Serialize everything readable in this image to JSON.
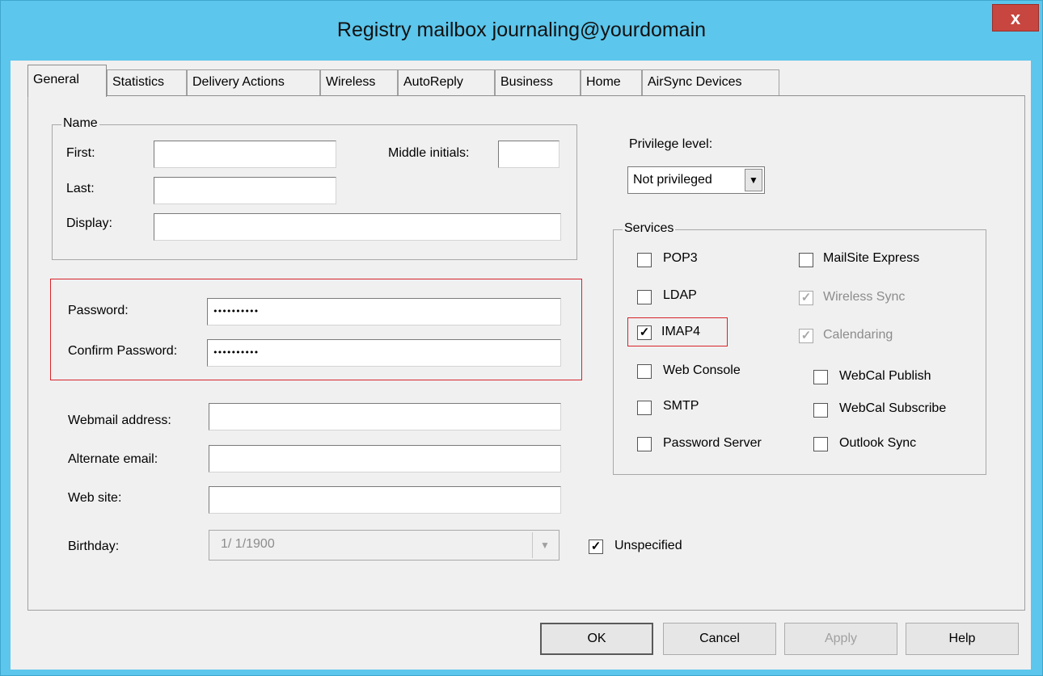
{
  "window": {
    "title": "Registry mailbox journaling@yourdomain",
    "close_label": "x"
  },
  "tabs": [
    {
      "label": "General"
    },
    {
      "label": "Statistics"
    },
    {
      "label": "Delivery Actions"
    },
    {
      "label": "Wireless"
    },
    {
      "label": "AutoReply"
    },
    {
      "label": "Business"
    },
    {
      "label": "Home"
    },
    {
      "label": "AirSync Devices"
    }
  ],
  "name_group": {
    "legend": "Name",
    "first_label": "First:",
    "first_value": "",
    "middle_label": "Middle initials:",
    "middle_value": "",
    "last_label": "Last:",
    "last_value": "",
    "display_label": "Display:",
    "display_value": ""
  },
  "password": {
    "password_label": "Password:",
    "password_value": "••••••••••",
    "confirm_label": "Confirm Password:",
    "confirm_value": "••••••••••"
  },
  "fields": {
    "webmail_label": "Webmail address:",
    "webmail_value": "",
    "alternate_label": "Alternate email:",
    "alternate_value": "",
    "website_label": "Web site:",
    "website_value": "",
    "birthday_label": "Birthday:",
    "birthday_value": "1/ 1/1900",
    "unspecified_label": "Unspecified",
    "unspecified_checked": true
  },
  "privilege": {
    "label": "Privilege level:",
    "value": "Not privileged"
  },
  "services": {
    "legend": "Services",
    "left": [
      {
        "label": "POP3",
        "checked": false,
        "enabled": true
      },
      {
        "label": "LDAP",
        "checked": false,
        "enabled": true
      },
      {
        "label": "IMAP4",
        "checked": true,
        "enabled": true
      },
      {
        "label": "Web Console",
        "checked": false,
        "enabled": true
      },
      {
        "label": "SMTP",
        "checked": false,
        "enabled": true
      },
      {
        "label": "Password Server",
        "checked": false,
        "enabled": true
      }
    ],
    "right": [
      {
        "label": "MailSite Express",
        "checked": false,
        "enabled": true
      },
      {
        "label": "Wireless Sync",
        "checked": true,
        "enabled": false
      },
      {
        "label": "Calendaring",
        "checked": true,
        "enabled": false
      },
      {
        "label": "WebCal Publish",
        "checked": false,
        "enabled": true
      },
      {
        "label": "WebCal Subscribe",
        "checked": false,
        "enabled": true
      },
      {
        "label": "Outlook Sync",
        "checked": false,
        "enabled": true
      }
    ]
  },
  "buttons": {
    "ok": "OK",
    "cancel": "Cancel",
    "apply": "Apply",
    "help": "Help"
  },
  "check_glyph": "✓",
  "colors": {
    "title_bar": "#5cc6ec",
    "highlight": "#d7232a",
    "close": "#c7463f"
  }
}
